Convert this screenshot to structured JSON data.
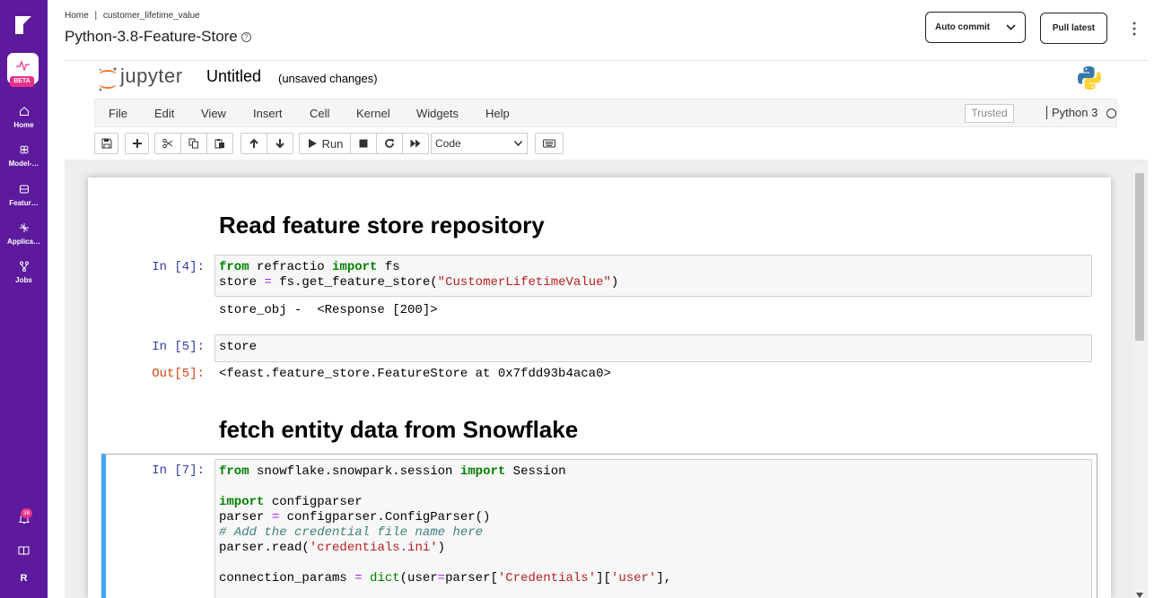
{
  "sidebar": {
    "beta_label": "BETA",
    "items": [
      {
        "label": "Home",
        "icon": "home-icon"
      },
      {
        "label": "Model-…",
        "icon": "model-icon"
      },
      {
        "label": "Featur…",
        "icon": "feature-store-icon"
      },
      {
        "label": "Applica…",
        "icon": "applications-icon"
      },
      {
        "label": "Jobs",
        "icon": "jobs-icon"
      }
    ],
    "notification_count": "38",
    "user_initial": "R",
    "brand_color": "#5d1a9c",
    "badge_color": "#e8308a"
  },
  "header": {
    "breadcrumb": [
      "Home",
      "|",
      "customer_lifetime_value"
    ],
    "title": "Python-3.8-Feature-Store",
    "auto_commit_label": "Auto commit",
    "pull_latest_label": "Pull latest"
  },
  "jupyter": {
    "logo_text": "jupyter",
    "notebook_name": "Untitled",
    "save_status": "(unsaved changes)",
    "menu": [
      "File",
      "Edit",
      "View",
      "Insert",
      "Cell",
      "Kernel",
      "Widgets",
      "Help"
    ],
    "trusted_label": "Trusted",
    "kernel_name": "Python 3",
    "run_label": "Run",
    "cell_type": "Code"
  },
  "notebook": {
    "heading1": "Read feature store repository",
    "cell4": {
      "prompt": "In [4]:",
      "line1": [
        "from",
        " refractio ",
        "import",
        " fs"
      ],
      "line2": [
        "store ",
        "=",
        " fs.get_feature_store(",
        "\"CustomerLifetimeValue\"",
        ")"
      ],
      "output": "store_obj -  <Response [200]>"
    },
    "cell5": {
      "prompt": "In [5]:",
      "code": "store",
      "out_prompt": "Out[5]:",
      "output": "<feast.feature_store.FeatureStore at 0x7fdd93b4aca0>"
    },
    "heading2": "fetch entity data from Snowflake",
    "cell7": {
      "prompt": "In [7]:",
      "l1": [
        "from",
        " snowflake.snowpark.session ",
        "import",
        " Session"
      ],
      "l3": [
        "import",
        " configparser"
      ],
      "l4": [
        "parser ",
        "=",
        " configparser.ConfigParser()"
      ],
      "l5": "# Add the credential file name here",
      "l6": [
        "parser.read(",
        "'credentials.ini'",
        ")"
      ],
      "l8": [
        "connection_params ",
        "=",
        " ",
        "dict",
        "(user",
        "=",
        "parser[",
        "'Credentials'",
        "][",
        "'user'",
        "],"
      ]
    }
  }
}
